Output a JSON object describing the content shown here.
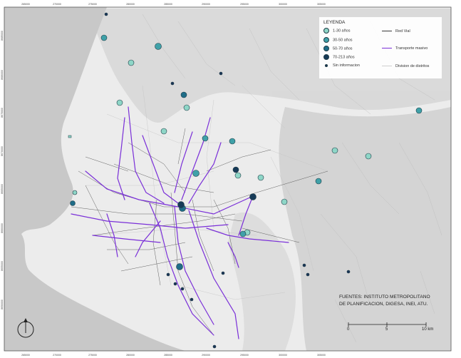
{
  "legend": {
    "title": "LEYENDA",
    "age_classes": [
      {
        "label": "1-30 años",
        "color": "#8ed6c7"
      },
      {
        "label": "30-50 años",
        "color": "#3fa1a8"
      },
      {
        "label": "50-70 años",
        "color": "#1f6d88"
      },
      {
        "label": "70-213 años",
        "color": "#163a57"
      },
      {
        "label": "Sin informacion",
        "color": "#1a3557"
      }
    ],
    "line_items": [
      {
        "label": "Red Vial",
        "color": "#3a3a3a"
      },
      {
        "label": "Transporte masivo",
        "color": "#7a2fd8"
      },
      {
        "label": "Division de distritos",
        "color": "#cfcfcf"
      }
    ]
  },
  "sources": {
    "line1": "FUENTES: INSTITUTO METROPOLITANO",
    "line2": "DE PLANIFICACION, DIGESA, INEI, ATU."
  },
  "scale_bar": {
    "labels": [
      "0",
      "5",
      "10 km"
    ]
  },
  "axis_ticks": {
    "top": [
      "265000",
      "270000",
      "275000",
      "280000",
      "285000",
      "290000",
      "295000",
      "300000",
      "305000"
    ],
    "bottom": [
      "265000",
      "270000",
      "275000",
      "280000",
      "285000",
      "290000",
      "295000",
      "300000",
      "305000"
    ],
    "left": [
      "8685000",
      "8680000",
      "8675000",
      "8670000",
      "8665000",
      "8660000",
      "8655000",
      "8650000"
    ]
  },
  "colors": {
    "water": "#c9c9c9",
    "land": "#ececec",
    "road": "#3a3a3a",
    "transit": "#7a2fd8",
    "district": "#cfcfcf",
    "hill": "#d4d4d4"
  }
}
